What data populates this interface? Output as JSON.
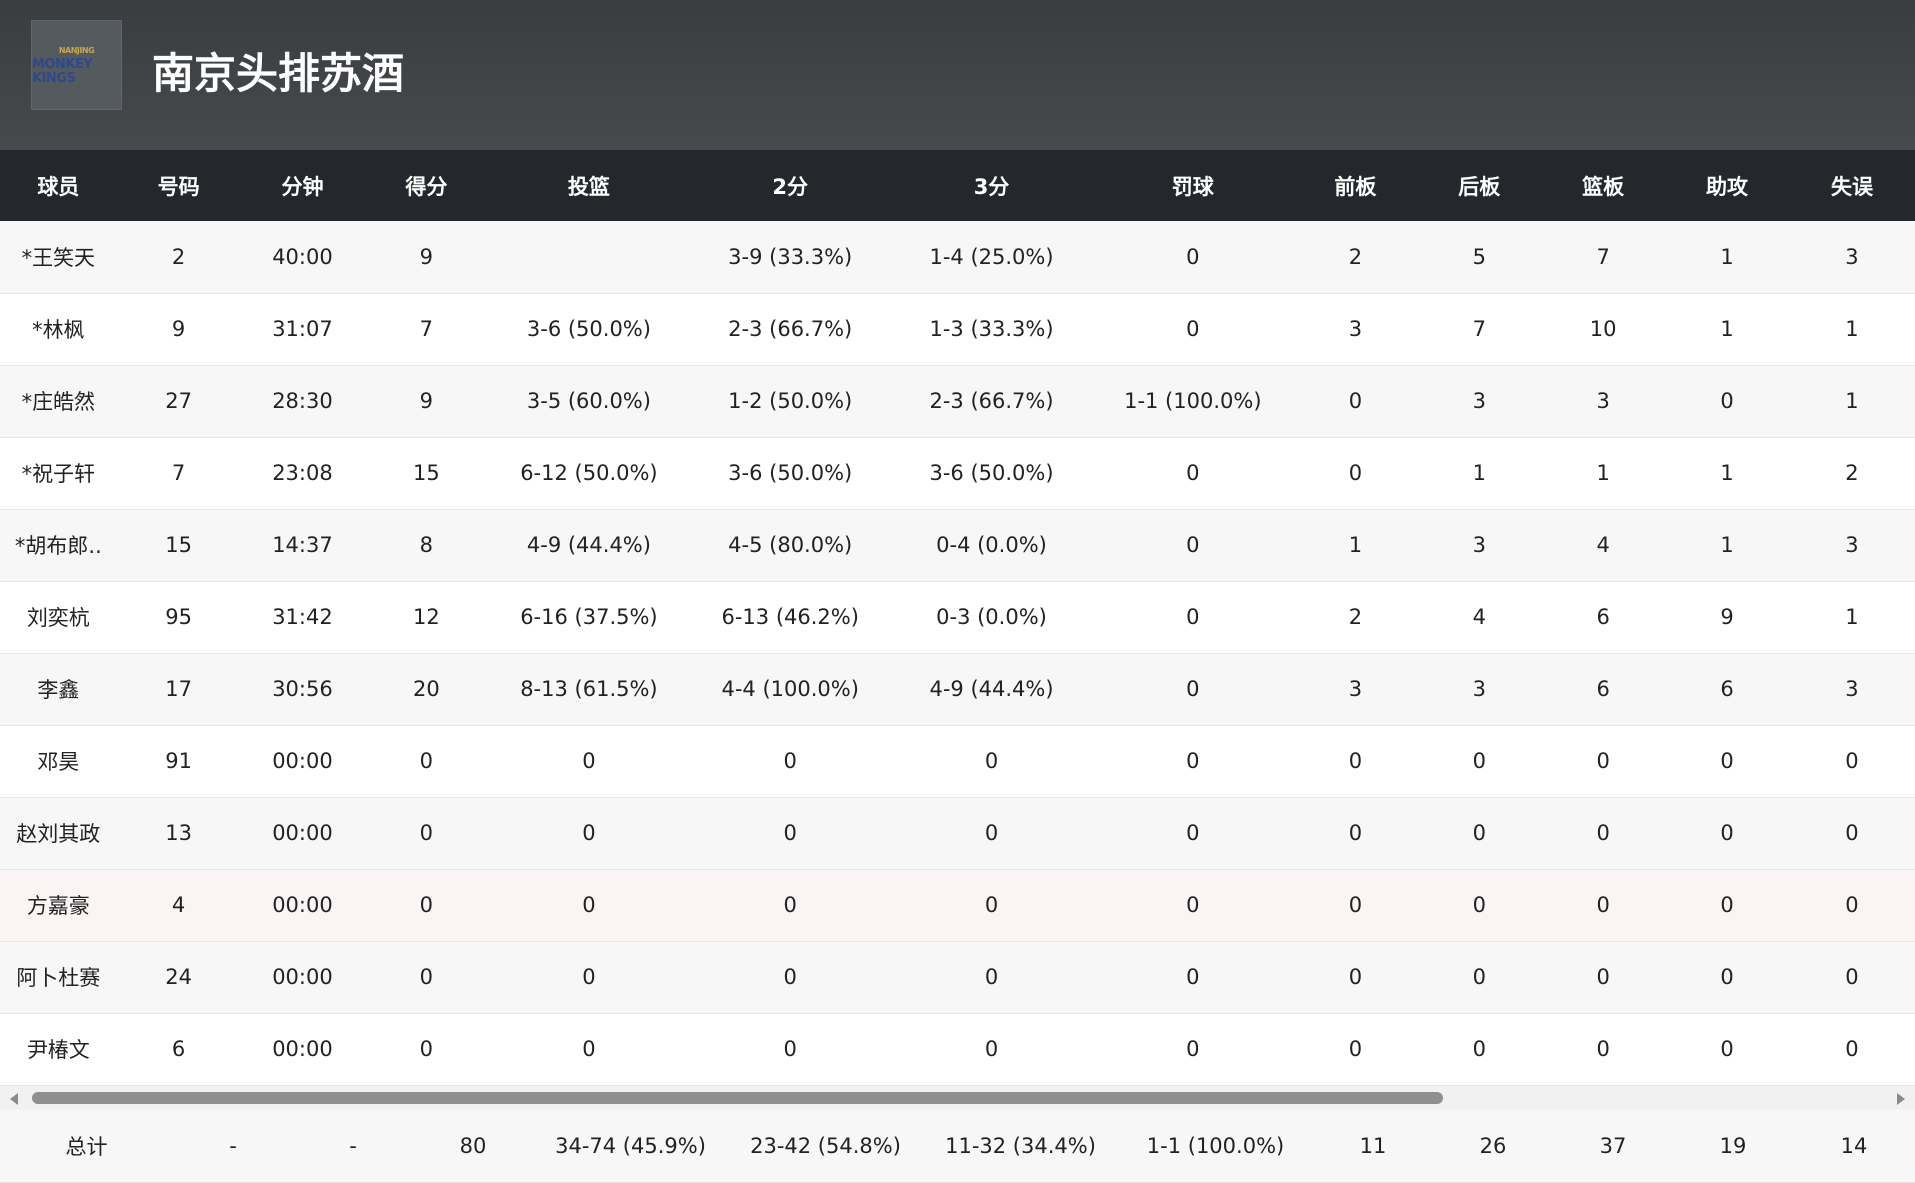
{
  "team": {
    "name": "南京头排苏酒",
    "logo_text": "MONKEY KINGS",
    "logo_top": "NANJING"
  },
  "columns": [
    "球员",
    "号码",
    "分钟",
    "得分",
    "投篮",
    "2分",
    "3分",
    "罚球",
    "前板",
    "后板",
    "篮板",
    "助攻",
    "失误"
  ],
  "rows": [
    {
      "player": "*王笑天",
      "num": "2",
      "min": "40:00",
      "pts": "9",
      "fg": "",
      "two": "3-9 (33.3%)",
      "three": "1-4 (25.0%)",
      "ft": "0",
      "oreb": "2",
      "dreb": "5",
      "reb": "7",
      "ast": "1",
      "tov": "3"
    },
    {
      "player": "*林枫",
      "num": "9",
      "min": "31:07",
      "pts": "7",
      "fg": "3-6 (50.0%)",
      "two": "2-3 (66.7%)",
      "three": "1-3 (33.3%)",
      "ft": "0",
      "oreb": "3",
      "dreb": "7",
      "reb": "10",
      "ast": "1",
      "tov": "1"
    },
    {
      "player": "*庄皓然",
      "num": "27",
      "min": "28:30",
      "pts": "9",
      "fg": "3-5 (60.0%)",
      "two": "1-2 (50.0%)",
      "three": "2-3 (66.7%)",
      "ft": "1-1 (100.0%)",
      "oreb": "0",
      "dreb": "3",
      "reb": "3",
      "ast": "0",
      "tov": "1"
    },
    {
      "player": "*祝子轩",
      "num": "7",
      "min": "23:08",
      "pts": "15",
      "fg": "6-12 (50.0%)",
      "two": "3-6 (50.0%)",
      "three": "3-6 (50.0%)",
      "ft": "0",
      "oreb": "0",
      "dreb": "1",
      "reb": "1",
      "ast": "1",
      "tov": "2"
    },
    {
      "player": "*胡布郎..",
      "num": "15",
      "min": "14:37",
      "pts": "8",
      "fg": "4-9 (44.4%)",
      "two": "4-5 (80.0%)",
      "three": "0-4 (0.0%)",
      "ft": "0",
      "oreb": "1",
      "dreb": "3",
      "reb": "4",
      "ast": "1",
      "tov": "3"
    },
    {
      "player": "刘奕杭",
      "num": "95",
      "min": "31:42",
      "pts": "12",
      "fg": "6-16 (37.5%)",
      "two": "6-13 (46.2%)",
      "three": "0-3 (0.0%)",
      "ft": "0",
      "oreb": "2",
      "dreb": "4",
      "reb": "6",
      "ast": "9",
      "tov": "1"
    },
    {
      "player": "李鑫",
      "num": "17",
      "min": "30:56",
      "pts": "20",
      "fg": "8-13 (61.5%)",
      "two": "4-4 (100.0%)",
      "three": "4-9 (44.4%)",
      "ft": "0",
      "oreb": "3",
      "dreb": "3",
      "reb": "6",
      "ast": "6",
      "tov": "3"
    },
    {
      "player": "邓昊",
      "num": "91",
      "min": "00:00",
      "pts": "0",
      "fg": "0",
      "two": "0",
      "three": "0",
      "ft": "0",
      "oreb": "0",
      "dreb": "0",
      "reb": "0",
      "ast": "0",
      "tov": "0"
    },
    {
      "player": "赵刘其政",
      "num": "13",
      "min": "00:00",
      "pts": "0",
      "fg": "0",
      "two": "0",
      "three": "0",
      "ft": "0",
      "oreb": "0",
      "dreb": "0",
      "reb": "0",
      "ast": "0",
      "tov": "0"
    },
    {
      "player": "方嘉豪",
      "num": "4",
      "min": "00:00",
      "pts": "0",
      "fg": "0",
      "two": "0",
      "three": "0",
      "ft": "0",
      "oreb": "0",
      "dreb": "0",
      "reb": "0",
      "ast": "0",
      "tov": "0"
    },
    {
      "player": "阿卜杜赛",
      "num": "24",
      "min": "00:00",
      "pts": "0",
      "fg": "0",
      "two": "0",
      "three": "0",
      "ft": "0",
      "oreb": "0",
      "dreb": "0",
      "reb": "0",
      "ast": "0",
      "tov": "0"
    },
    {
      "player": "尹椿文",
      "num": "6",
      "min": "00:00",
      "pts": "0",
      "fg": "0",
      "two": "0",
      "three": "0",
      "ft": "0",
      "oreb": "0",
      "dreb": "0",
      "reb": "0",
      "ast": "0",
      "tov": "0"
    }
  ],
  "totals": {
    "label": "总计",
    "num": "-",
    "min": "-",
    "pts": "80",
    "fg": "34-74 (45.9%)",
    "two": "23-42 (54.8%)",
    "three": "11-32 (34.4%)",
    "ft": "1-1 (100.0%)",
    "oreb": "11",
    "dreb": "26",
    "reb": "37",
    "ast": "19",
    "tov": "14"
  },
  "scrollbar": {
    "position_percent": 0,
    "visible_fraction": 0.75
  }
}
